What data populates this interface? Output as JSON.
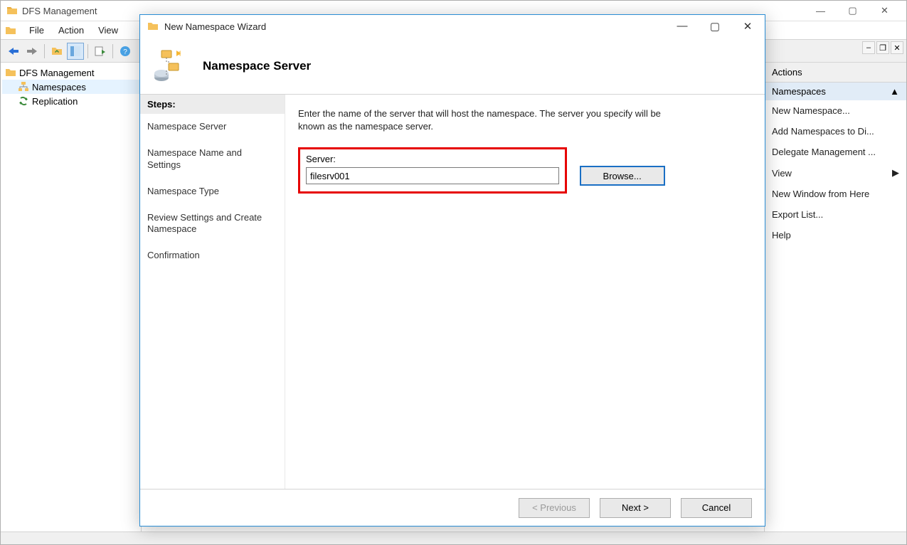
{
  "main_window": {
    "title": "DFS Management",
    "menubar": {
      "file": "File",
      "action": "Action",
      "view": "View"
    },
    "tree": {
      "root": "DFS Management",
      "child_namespaces": "Namespaces",
      "child_replication": "Replication"
    },
    "actions_panel": {
      "header": "Actions",
      "section": "Namespaces",
      "items": [
        "New Namespace...",
        "Add Namespaces to Di...",
        "Delegate Management ...",
        "View",
        "New Window from Here",
        "Export List...",
        "Help"
      ]
    }
  },
  "wizard": {
    "title": "New Namespace Wizard",
    "header_title": "Namespace Server",
    "steps_header": "Steps:",
    "steps": [
      "Namespace Server",
      "Namespace Name and Settings",
      "Namespace Type",
      "Review Settings and Create Namespace",
      "Confirmation"
    ],
    "instruction": "Enter the name of the server that will host the namespace. The server you specify will be known as the namespace server.",
    "server_label": "Server:",
    "server_value": "filesrv001",
    "browse": "Browse...",
    "btn_previous": "< Previous",
    "btn_next": "Next >",
    "btn_cancel": "Cancel"
  }
}
